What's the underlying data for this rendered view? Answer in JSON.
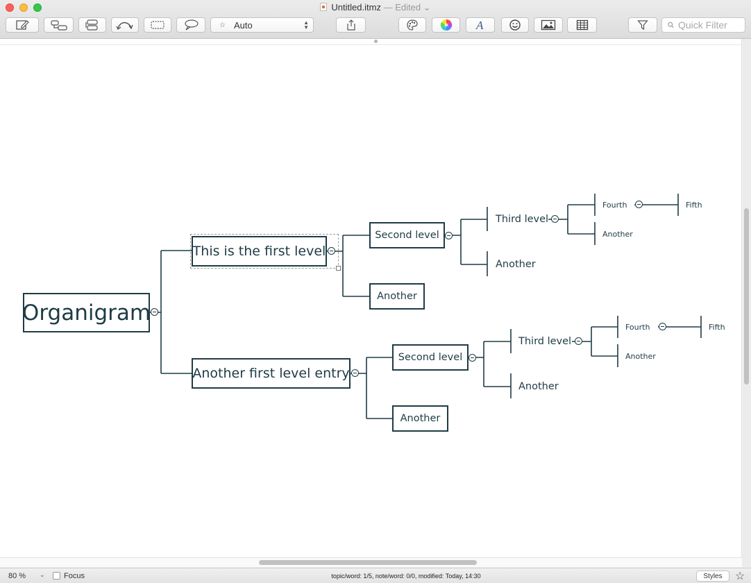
{
  "window": {
    "title": "Untitled.itmz",
    "edited": "— Edited ⌄"
  },
  "toolbar": {
    "buttons": [
      {
        "name": "new-note-icon"
      },
      {
        "name": "add-child-topic-icon"
      },
      {
        "name": "add-sibling-topic-icon"
      },
      {
        "name": "relationship-icon"
      },
      {
        "name": "boundary-icon"
      },
      {
        "name": "callout-icon"
      }
    ],
    "layout_popup": "Auto",
    "share": "share-icon",
    "format": [
      "style-palette-icon",
      "color-wheel-icon",
      "font-icon",
      "emoji-icon",
      "image-icon",
      "table-icon"
    ],
    "filter": "filter-icon",
    "search_placeholder": "Quick Filter"
  },
  "map": {
    "central": "Organigram",
    "branches": [
      {
        "label": "This is the first level",
        "selected": true,
        "children": [
          {
            "label": "Second level",
            "children": [
              {
                "label": "Third level",
                "children": [
                  {
                    "label": "Fourth",
                    "children": [
                      {
                        "label": "Fifth"
                      }
                    ]
                  },
                  {
                    "label": "Another"
                  }
                ]
              },
              {
                "label": "Another"
              }
            ]
          },
          {
            "label": "Another"
          }
        ]
      },
      {
        "label": "Another first level entry",
        "children": [
          {
            "label": "Second level",
            "children": [
              {
                "label": "Third level",
                "children": [
                  {
                    "label": "Fourth",
                    "children": [
                      {
                        "label": "Fifth"
                      }
                    ]
                  },
                  {
                    "label": "Another"
                  }
                ]
              },
              {
                "label": "Another"
              }
            ]
          },
          {
            "label": "Another"
          }
        ]
      }
    ]
  },
  "status": {
    "zoom": "80 %",
    "focus_label": "Focus",
    "focus_checked": false,
    "stats": "topic/word: 1/5, note/word: 0/0, modified: Today, 14:30",
    "styles_label": "Styles"
  },
  "colors": {
    "topic_border": "#1f3b45",
    "selection": "#9a9a9a"
  }
}
